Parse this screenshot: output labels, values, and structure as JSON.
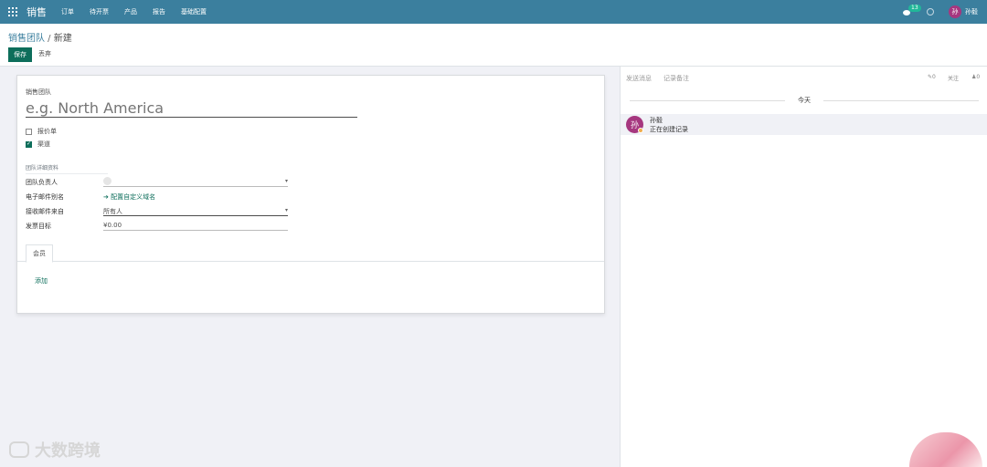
{
  "navbar": {
    "brand": "销售",
    "menu": [
      "订单",
      "待开票",
      "产品",
      "报告",
      "基础配置"
    ],
    "message_count": "13",
    "user_initial": "孙",
    "user_name": "孙毅"
  },
  "control": {
    "breadcrumb_parent": "销售团队",
    "breadcrumb_separator": " / ",
    "breadcrumb_current": "新建",
    "save_label": "保存",
    "discard_label": "丢弃"
  },
  "form": {
    "name_label": "销售团队",
    "name_placeholder": "e.g. North America",
    "checkbox_quotations": {
      "label": "报价单",
      "checked": false
    },
    "checkbox_pipeline": {
      "label": "渠道",
      "checked": true
    },
    "group_title": "团队详细资料",
    "leader_label": "团队负责人",
    "leader_value": "",
    "alias_label": "电子邮件别名",
    "alias_link": "➔ 配置自定义域名",
    "accept_from_label": "接收邮件来自",
    "accept_from_value": "所有人",
    "invoice_target_label": "发票目标",
    "invoice_target_value": "¥0.00",
    "tab_members": "会员",
    "add_label": "添加"
  },
  "chatter": {
    "send_message": "发送消息",
    "log_note": "记录备注",
    "attachments_count": "0",
    "follow_label": "关注",
    "followers_count": "0",
    "day_label": "今天",
    "message": {
      "avatar_initial": "孙",
      "author": "孙毅",
      "body": "正在创建记录"
    }
  },
  "watermark": {
    "text": "大数跨境"
  },
  "colors": {
    "navbar": "#3b7f9e",
    "primary": "#0d6e5b",
    "avatar": "#a6377f",
    "badge": "#21b799"
  }
}
